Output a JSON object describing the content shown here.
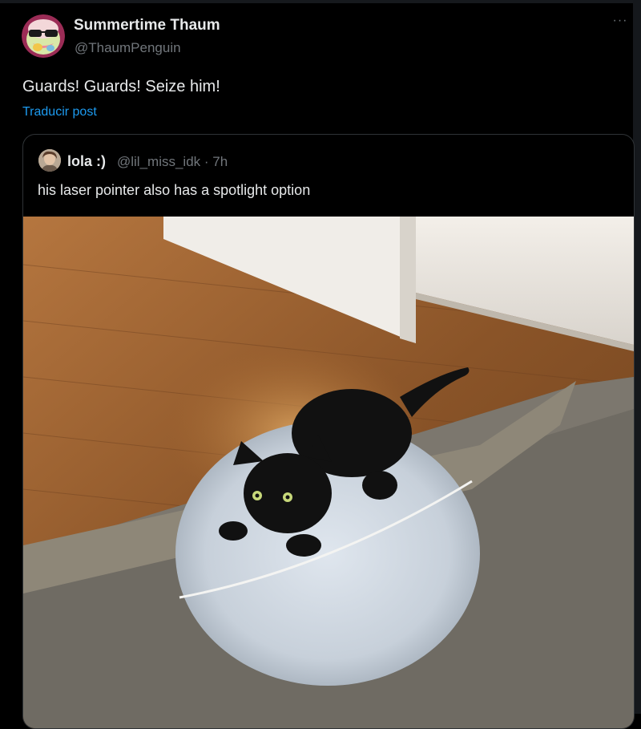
{
  "post": {
    "author": {
      "display_name": "Summertime Thaum",
      "handle": "@ThaumPenguin",
      "avatar_icon": "penguin-sunglasses-avatar-icon"
    },
    "more_icon": "more-horizontal-icon",
    "more_label": "···",
    "text": "Guards! Guards! Seize him!",
    "translate_label": "Traducir post"
  },
  "quote": {
    "author": {
      "display_name": "lola :)",
      "meta": "@lil_miss_idk · 7h",
      "avatar_icon": "user-photo-avatar-icon"
    },
    "text": "his laser pointer also has a spotlight option",
    "media": {
      "kind": "photo",
      "subject": "black-kitten-in-spotlight-image"
    }
  },
  "colors": {
    "background": "#000000",
    "primary_text": "#e7e9ea",
    "secondary_text": "#71767b",
    "link": "#1d9bf0",
    "border": "#2f3336"
  }
}
